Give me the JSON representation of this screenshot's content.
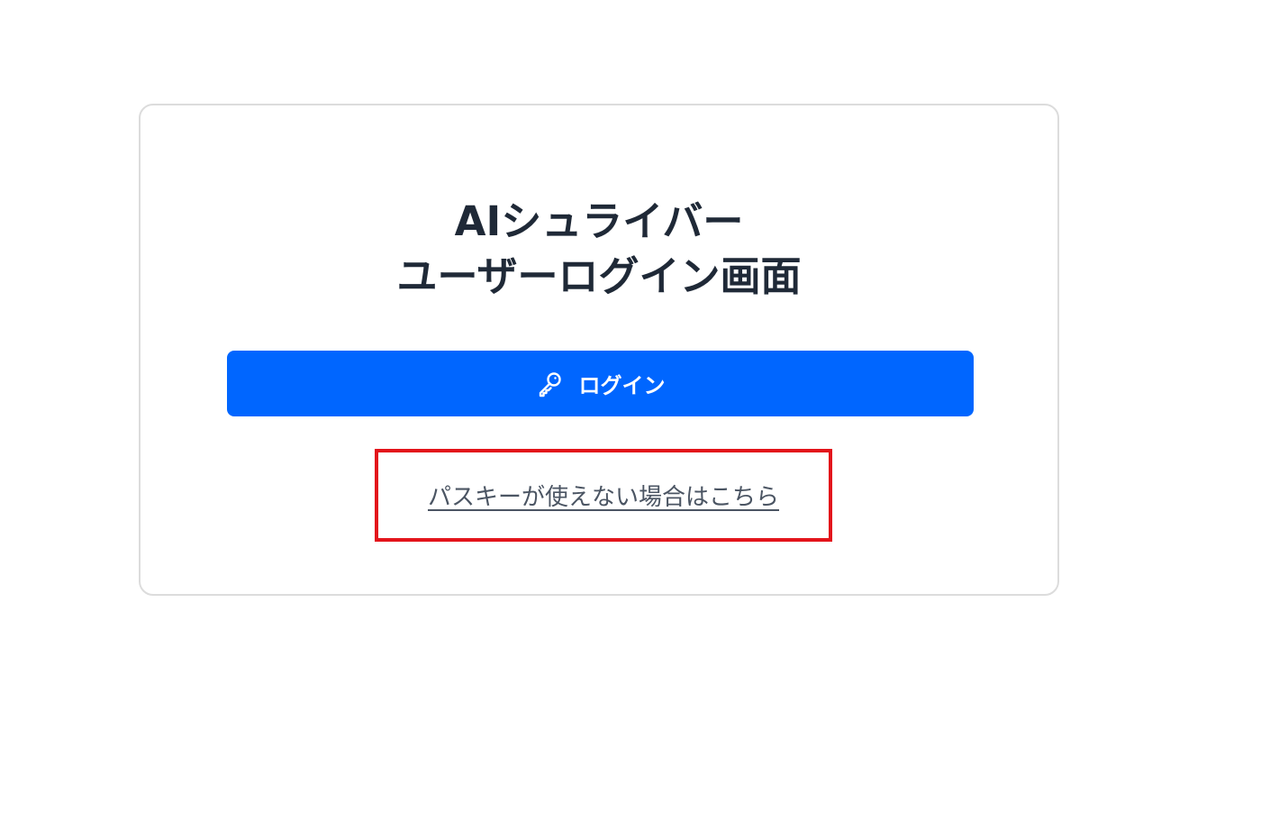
{
  "login_card": {
    "title_line_1": "AIシュライバー",
    "title_line_2": "ユーザーログイン画面",
    "login_button": {
      "label": "ログイン",
      "icon": "key-icon",
      "color": "#0066ff"
    },
    "fallback_link": {
      "label": "パスキーが使えない場合はこちら",
      "highlight_color": "#e3141b"
    }
  }
}
